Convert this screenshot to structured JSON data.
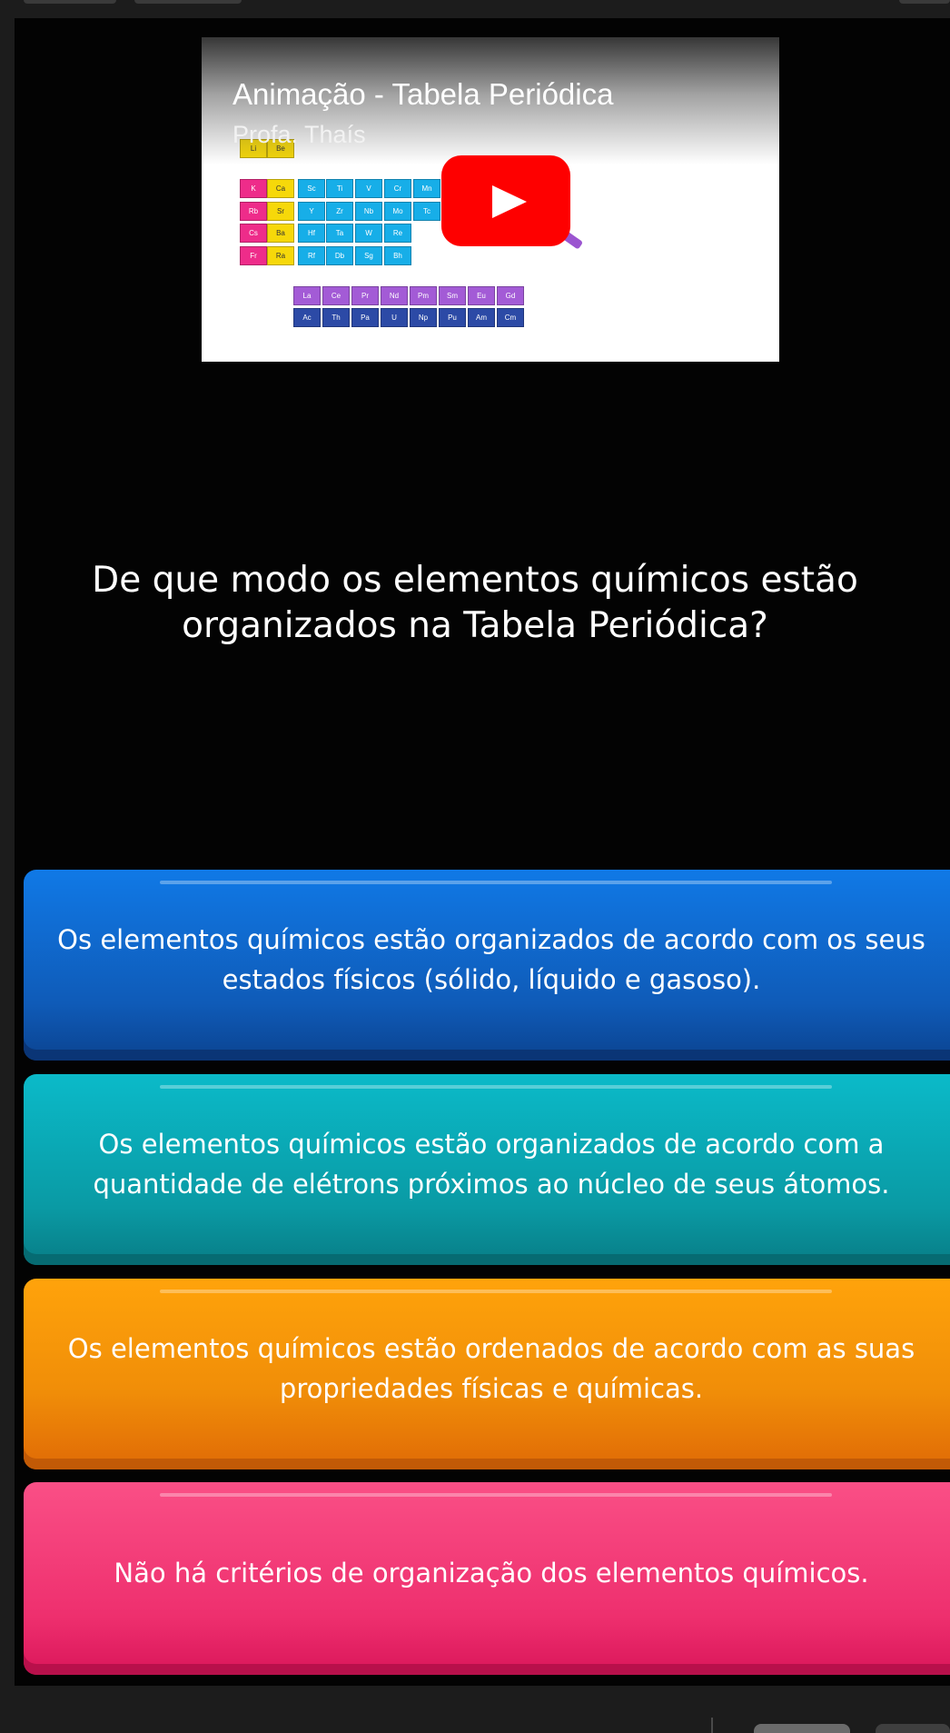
{
  "video": {
    "title": "Animação - Tabela Periódica",
    "subtitle": "Profa. Thaís",
    "play_icon": "play-icon",
    "brand_color": "#fe0000",
    "table_rows": [
      [
        "Li",
        "Be"
      ],
      [
        "K",
        "Ca",
        "Sc",
        "Ti",
        "V",
        "Cr",
        "Mn"
      ],
      [
        "Rb",
        "Sr",
        "Y",
        "Zr",
        "Nb",
        "Mo",
        "Tc"
      ],
      [
        "Cs",
        "Ba",
        "Hf",
        "Ta",
        "W",
        "Re"
      ],
      [
        "Fr",
        "Ra",
        "Rf",
        "Db",
        "Sg",
        "Bh"
      ]
    ],
    "lanthanides": [
      "La",
      "Ce",
      "Pr",
      "Nd",
      "Pm",
      "Sm",
      "Eu",
      "Gd"
    ],
    "actinides": [
      "Ac",
      "Th",
      "Pa",
      "U",
      "Np",
      "Pu",
      "Am",
      "Cm"
    ]
  },
  "question": "De que modo os elementos químicos estão organizados na Tabela Periódica?",
  "answers": [
    {
      "text": "Os elementos químicos estão organizados de acordo com os seus estados físicos (sólido, líquido e gasoso).",
      "color": "#1079e6"
    },
    {
      "text": "Os elementos químicos estão organizados de acordo com a quantidade de elétrons próximos ao núcleo de seus átomos.",
      "color": "#0bbac9"
    },
    {
      "text": "Os elementos químicos estão ordenados de acordo com as suas propriedades físicas e químicas.",
      "color": "#ffa30b"
    },
    {
      "text": "Não há critérios de organização dos elementos químicos.",
      "color": "#fa4f86"
    }
  ]
}
